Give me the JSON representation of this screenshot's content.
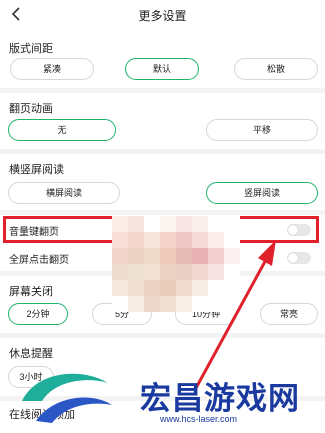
{
  "header": {
    "title": "更多设置",
    "back_icon": "chevron-left-icon"
  },
  "sections": {
    "layout_spacing": {
      "title": "版式间距",
      "options": [
        "紧凑",
        "默认",
        "松散"
      ],
      "selected": "默认"
    },
    "page_animation": {
      "title": "翻页动画",
      "options": [
        "无",
        "平移"
      ],
      "selected": "无"
    },
    "orientation": {
      "title": "横竖屏阅读",
      "options": [
        "横屏阅读",
        "竖屏阅读"
      ],
      "selected": "竖屏阅读"
    },
    "volume_key_flip": {
      "label": "音量键翻页",
      "enabled": false
    },
    "fullscreen_tap_flip": {
      "label": "全屏点击翻页",
      "enabled": false
    },
    "screen_off": {
      "title": "屏幕关闭",
      "options": [
        "2分钟",
        "5分",
        "10分钟",
        "常亮"
      ],
      "selected": "2分钟"
    },
    "rest_reminder": {
      "title": "休息提醒",
      "options": [
        "3小时"
      ]
    },
    "online_reading": {
      "title": "在线阅读预加"
    }
  },
  "colors": {
    "accent": "#1fb36b",
    "highlight_box": "#e0202a",
    "watermark": "#1a3aa0"
  },
  "watermark": {
    "name": "宏昌游戏网",
    "url": "www.hcs-laser.com"
  }
}
